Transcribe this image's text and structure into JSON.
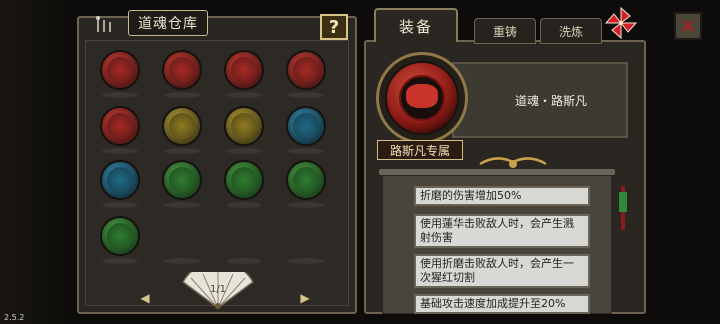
{
  "version": "2.5.2",
  "warehouse": {
    "title": "道魂仓库",
    "help_label": "?",
    "page": "1/1",
    "prev_icon": "◀",
    "next_icon": "▶",
    "orbs": [
      {
        "ring": "#5a1a18",
        "core": "#a82a24",
        "glyph": "#c43c32"
      },
      {
        "ring": "#5a1a18",
        "core": "#a82a24",
        "glyph": "#c43c32"
      },
      {
        "ring": "#5a1a18",
        "core": "#a82a24",
        "glyph": "#c43c32"
      },
      {
        "ring": "#5a1a18",
        "core": "#a82a24",
        "glyph": "#c43c32"
      },
      {
        "ring": "#5a1a18",
        "core": "#a82a24",
        "glyph": "#c43c32"
      },
      {
        "ring": "#4e4518",
        "core": "#8f7a20",
        "glyph": "#b09a36"
      },
      {
        "ring": "#4e4518",
        "core": "#8f7a20",
        "glyph": "#b09a36"
      },
      {
        "ring": "#173d4c",
        "core": "#1f6a86",
        "glyph": "#3288a8"
      },
      {
        "ring": "#173d4c",
        "core": "#1f6a86",
        "glyph": "#3288a8"
      },
      {
        "ring": "#1d4a1e",
        "core": "#2f7c30",
        "glyph": "#4c9a44"
      },
      {
        "ring": "#1d4a1e",
        "core": "#2f7c30",
        "glyph": "#4c9a44"
      },
      {
        "ring": "#1d4a1e",
        "core": "#2f7c30",
        "glyph": "#4c9a44"
      },
      {
        "ring": "#1d4a1e",
        "core": "#2f7c30",
        "glyph": "#4c9a44"
      }
    ]
  },
  "tabs": {
    "equip": "装备",
    "reforge": "重铸",
    "wash": "洗炼"
  },
  "close_label": "✕",
  "equipped": {
    "name": "道魂・路斯凡",
    "exclusive_tag": "路斯凡专属",
    "effects": [
      "折磨的伤害增加50%",
      "使用蓮华击败敌人时，会产生溅射伤害",
      "使用折磨击败敌人时，会产生一次猩红切割",
      "基础攻击速度加成提升至20%"
    ]
  },
  "colors": {
    "accent_gold": "#c9b88a",
    "pinwheel_red": "#d0202a",
    "close_red": "#b01e22"
  },
  "icons": {
    "help": "question-icon",
    "close": "close-icon",
    "pinwheel": "pinwheel-icon",
    "fan": "fan-icon"
  }
}
